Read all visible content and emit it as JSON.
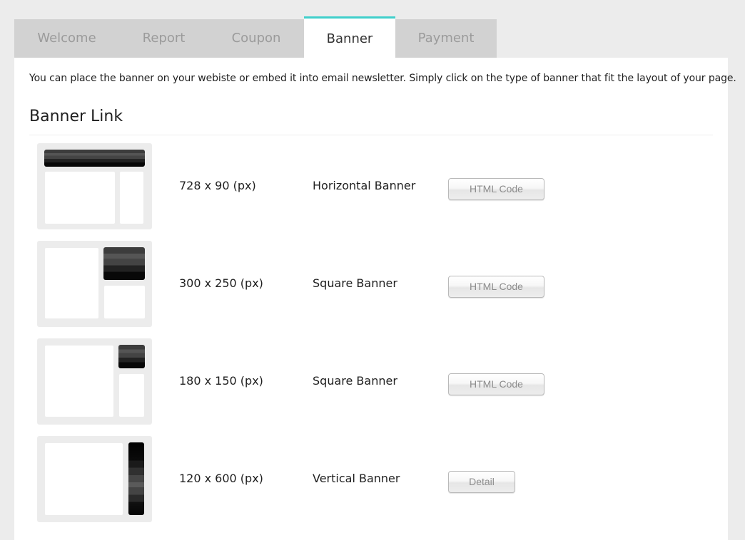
{
  "tabs": [
    {
      "label": "Welcome",
      "active": false
    },
    {
      "label": "Report",
      "active": false
    },
    {
      "label": "Coupon",
      "active": false
    },
    {
      "label": "Banner",
      "active": true
    },
    {
      "label": "Payment",
      "active": false
    }
  ],
  "intro_text": "You can place the banner on your webiste or embed it into email newsletter. Simply click on the type of banner that fit the layout of your page.",
  "section_title": "Banner Link",
  "banners": [
    {
      "size": "728 x 90 (px)",
      "type": "Horizontal Banner",
      "button_label": "HTML Code"
    },
    {
      "size": "300 x 250 (px)",
      "type": "Square Banner",
      "button_label": "HTML Code"
    },
    {
      "size": "180 x 150 (px)",
      "type": "Square Banner",
      "button_label": "HTML Code"
    },
    {
      "size": "120 x 600 (px)",
      "type": "Vertical Banner",
      "button_label": "Detail"
    }
  ],
  "colors": {
    "active_tab_accent": "#40cfcb",
    "page_background": "#ececec",
    "tab_bar": "#d2d2d2",
    "panel": "#ffffff"
  }
}
